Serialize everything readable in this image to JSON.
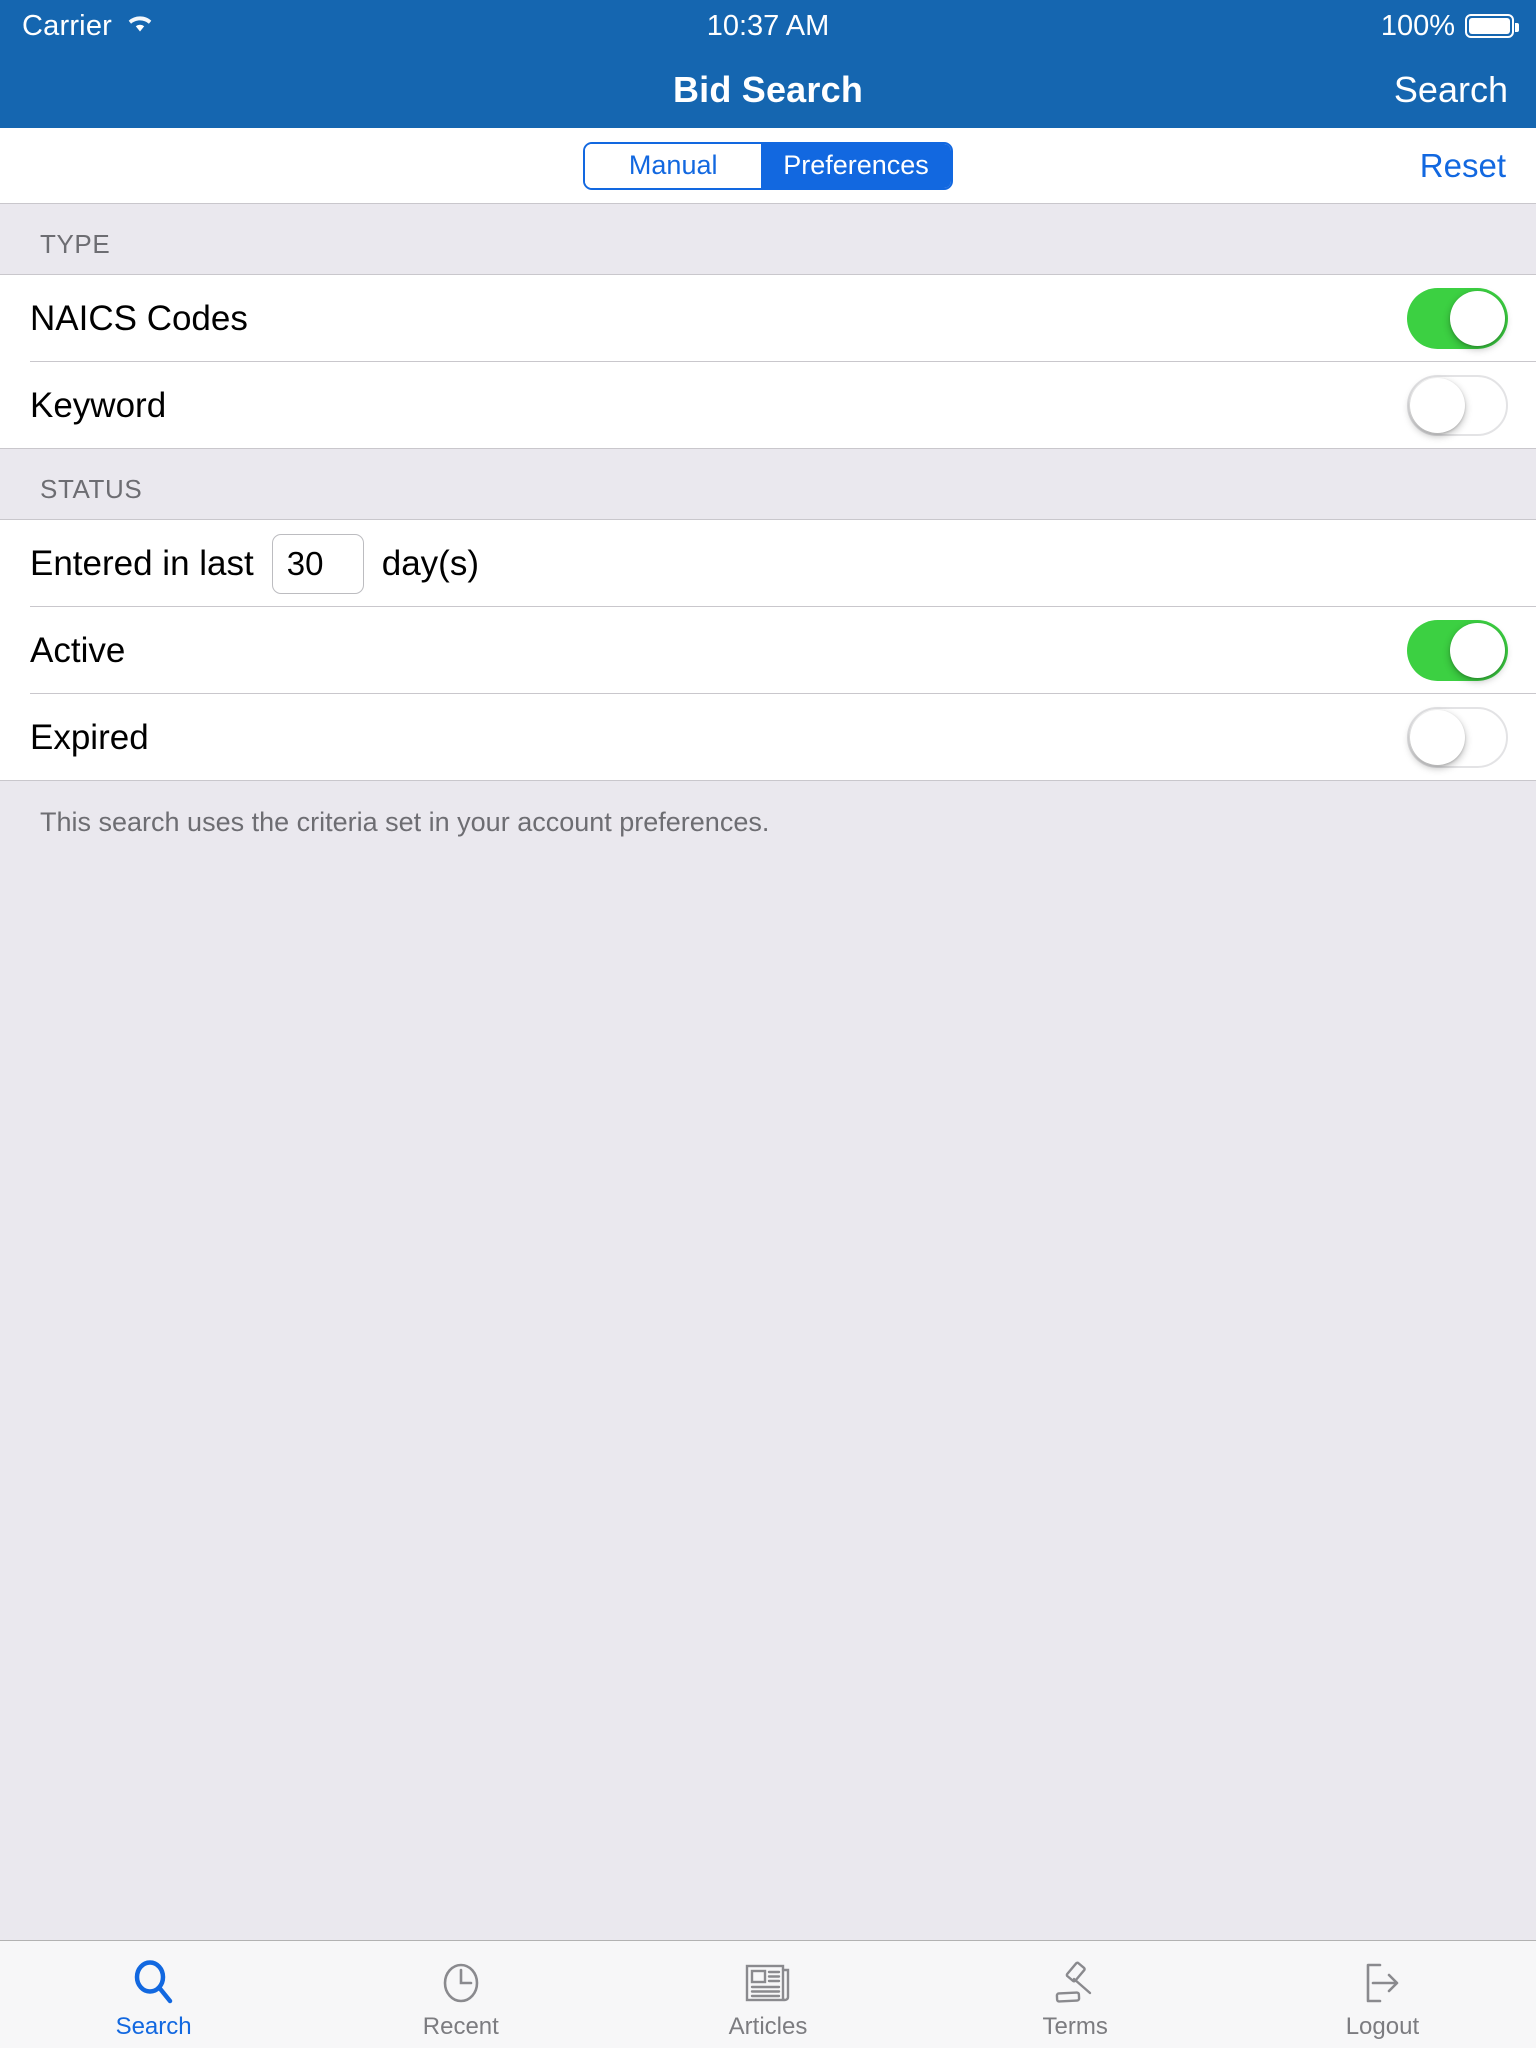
{
  "status_bar": {
    "carrier": "Carrier",
    "wifi_icon": "wifi-icon",
    "time": "10:37 AM",
    "battery_percent": "100%",
    "battery_icon": "battery-full-icon"
  },
  "nav_bar": {
    "title": "Bid Search",
    "right_action": "Search"
  },
  "toolbar": {
    "segments": [
      {
        "label": "Manual",
        "selected": false
      },
      {
        "label": "Preferences",
        "selected": true
      }
    ],
    "reset_label": "Reset"
  },
  "sections": [
    {
      "header": "TYPE",
      "rows": [
        {
          "label": "NAICS Codes",
          "control": "switch",
          "on": true
        },
        {
          "label": "Keyword",
          "control": "switch",
          "on": false
        }
      ]
    },
    {
      "header": "STATUS",
      "rows": [
        {
          "label": "Entered in last",
          "control": "number-input",
          "value": "30",
          "suffix": "day(s)"
        },
        {
          "label": "Active",
          "control": "switch",
          "on": true
        },
        {
          "label": "Expired",
          "control": "switch",
          "on": false
        }
      ]
    }
  ],
  "footer_note": "This search uses the criteria set in your account preferences.",
  "tab_bar": {
    "tabs": [
      {
        "label": "Search",
        "icon": "magnifier-icon",
        "active": true
      },
      {
        "label": "Recent",
        "icon": "clock-icon",
        "active": false
      },
      {
        "label": "Articles",
        "icon": "newspaper-icon",
        "active": false
      },
      {
        "label": "Terms",
        "icon": "gavel-icon",
        "active": false
      },
      {
        "label": "Logout",
        "icon": "logout-arrow-icon",
        "active": false
      }
    ]
  },
  "colors": {
    "nav_bar_blue": "#1566B0",
    "accent_blue": "#1268e0",
    "switch_on_green": "#3cd042",
    "group_background": "#EAE8EE",
    "separator": "#c9c7cc",
    "secondary_text": "#6d6d72"
  }
}
